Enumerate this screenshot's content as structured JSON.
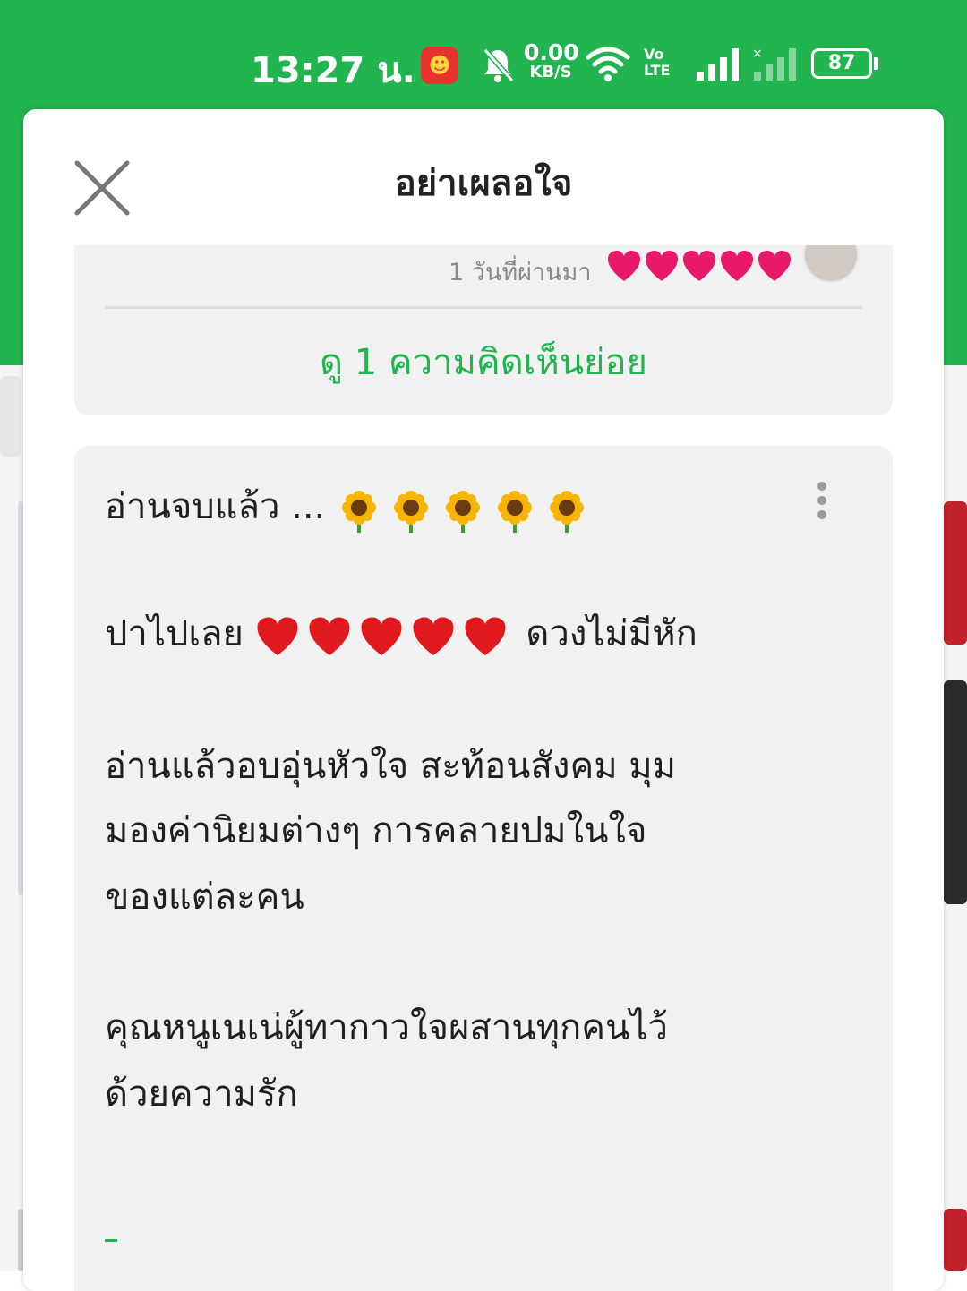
{
  "status_bar": {
    "time": "13:27 น.",
    "net_speed_value": "0.00",
    "net_speed_unit": "KB/S",
    "volte_line1": "Vo",
    "volte_line2": "LTE",
    "battery": "87",
    "icons": [
      "app-notification-icon",
      "bell-muted-icon",
      "wifi-icon",
      "signal-sim1-icon",
      "signal-sim2-icon",
      "battery-icon"
    ]
  },
  "sheet": {
    "title": "อย่าเผลอใจ"
  },
  "comment_prev": {
    "time_ago": "1 วันที่ผ่านมา",
    "hearts": 5,
    "view_replies": "ดู 1 ความคิดเห็นย่อย"
  },
  "comment": {
    "line1_text": "อ่านจบแล้ว ...",
    "line1_emoji_count": 5,
    "line2_text": "ปาไปเลย",
    "line2_emoji_count": 5,
    "line2_tail": "ดวงไม่มีหัก",
    "para2_line1": "อ่านแล้วอบอุ่นหัวใจ สะท้อนสังคม มุม",
    "para2_line2": "มองค่านิยมต่างๆ การคลายปมในใจ",
    "para2_line3": "ของแต่ละคน",
    "para3_line1": "คุณหนูเนเน่ผู้ทากาวใจผสานทุกคนไว้",
    "para3_line2": "ด้วยความรัก"
  },
  "colors": {
    "brand_green": "#21b44f",
    "heart_pink": "#e8196a",
    "heart_red": "#e0191f",
    "card_bg": "#f1f1f1"
  }
}
